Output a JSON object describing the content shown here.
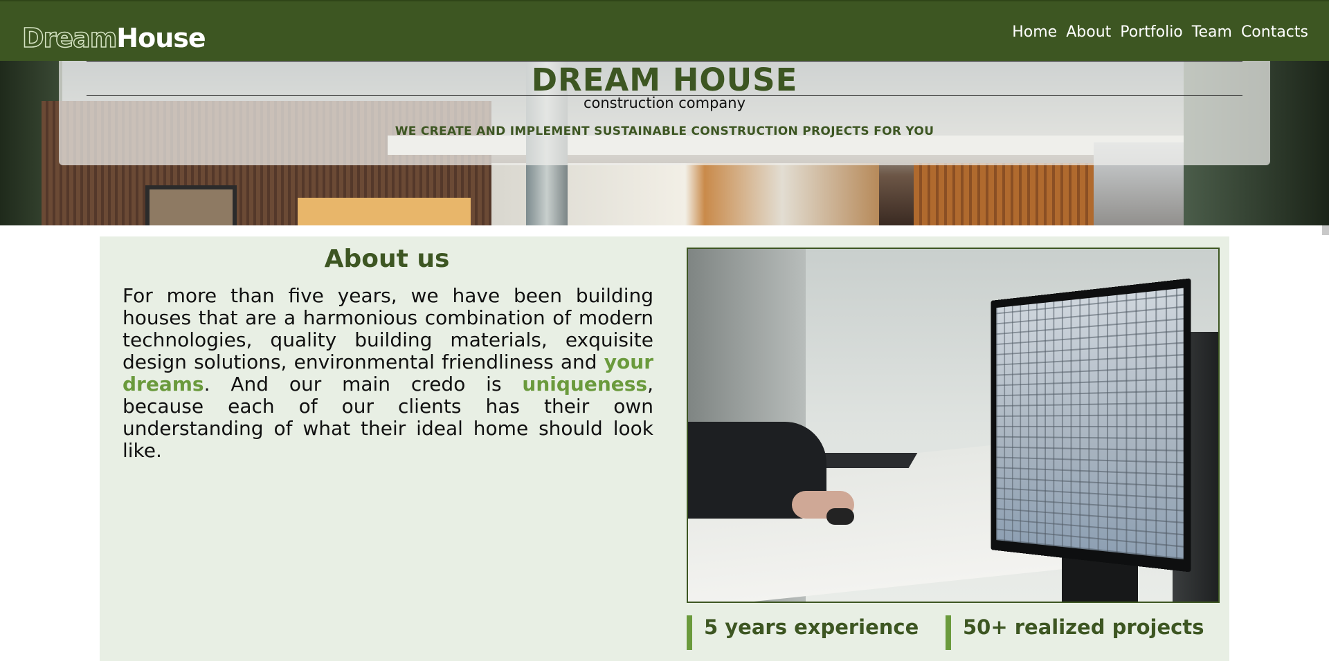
{
  "nav": {
    "logo_part1": "Dream",
    "logo_part2": "House",
    "links": [
      "Home",
      "About",
      "Portfolio",
      "Team",
      "Contacts"
    ]
  },
  "hero": {
    "title": "DREAM HOUSE",
    "subtitle": "construction company",
    "tagline": "WE CREATE AND IMPLEMENT SUSTAINABLE CONSTRUCTION PROJECTS FOR YOU"
  },
  "about": {
    "title": "About us",
    "text_part1": "For more than five years, we have been building houses that are a harmonious combination of modern technologies, quality building materials, exquisite design solutions, environmental friendliness and ",
    "highlight1": "your dreams",
    "text_part2": ". And our main credo is ",
    "highlight2": "uniqueness",
    "text_part3": ", because each of our clients has their own understanding of what their ideal home should look like.",
    "stats": [
      "5 years experience",
      "50+ realized projects"
    ]
  },
  "colors": {
    "brand_dark_green": "#3d5622",
    "accent_green": "#6a9a3c",
    "section_bg": "#e8efe4"
  }
}
